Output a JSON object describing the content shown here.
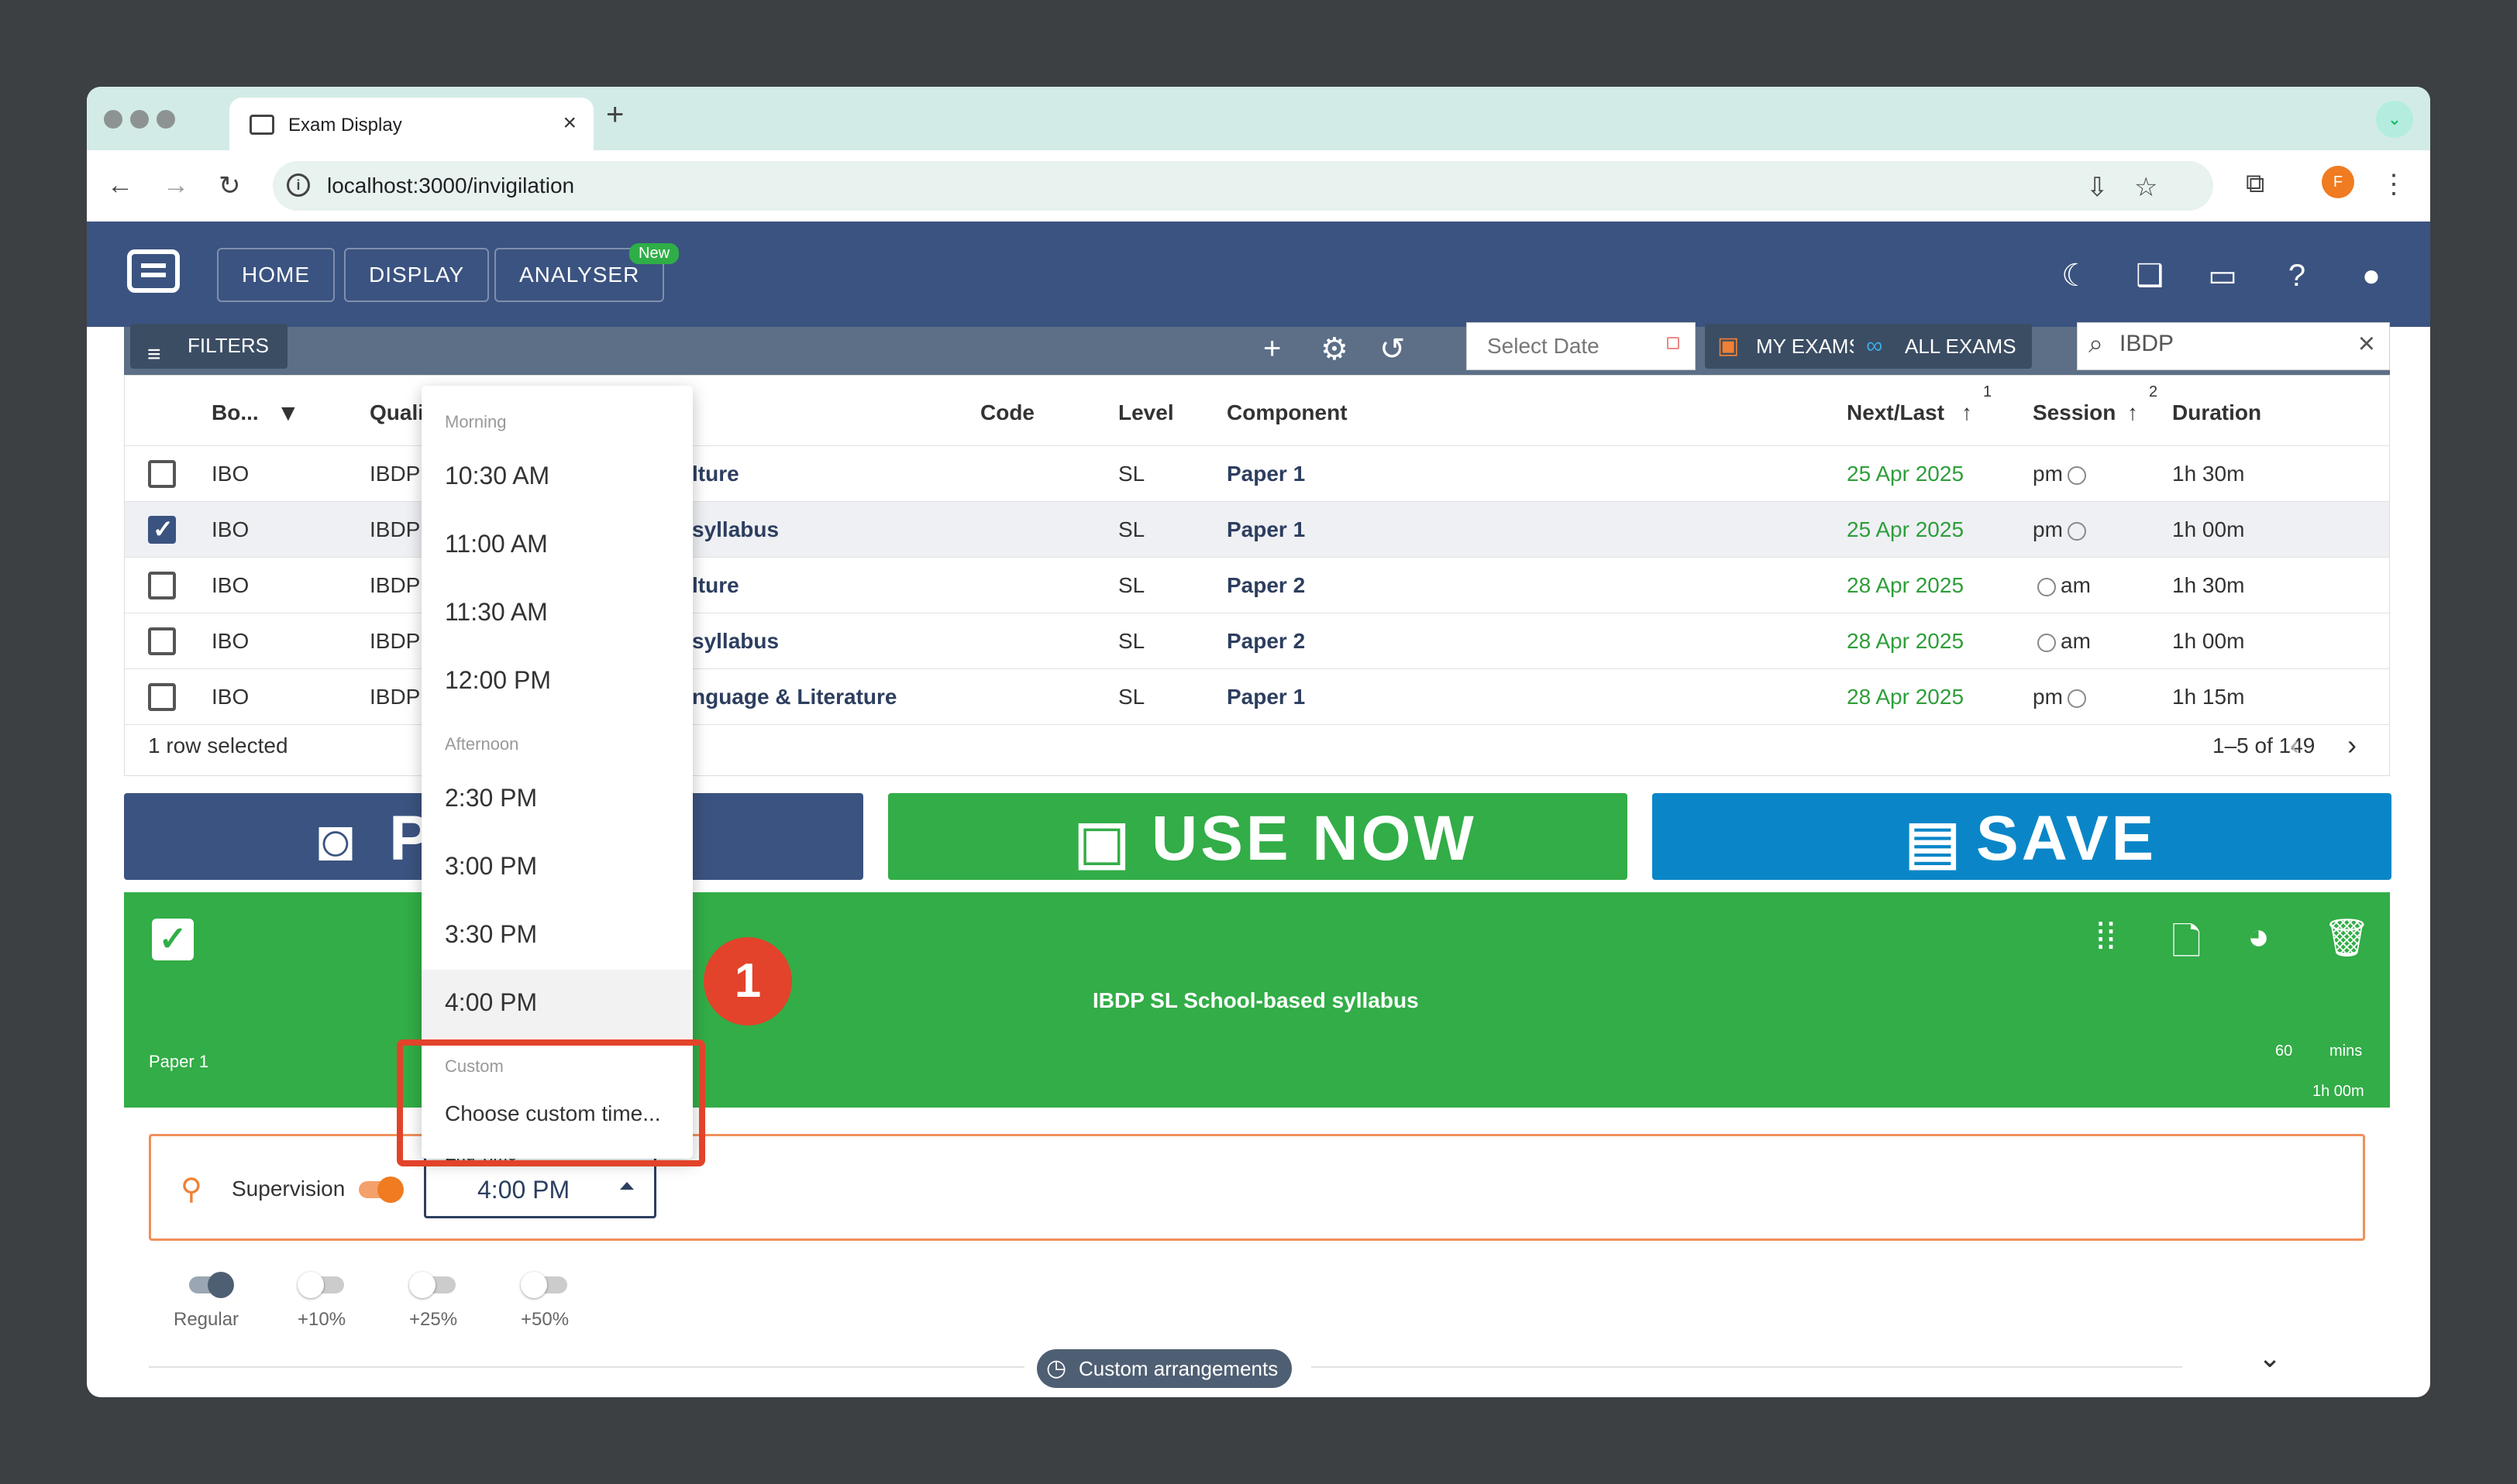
{
  "browser": {
    "tab_title": "Exam Display",
    "url": "localhost:3000/invigilation",
    "profile_initial": "F"
  },
  "app": {
    "nav": [
      "HOME",
      "DISPLAY",
      "ANALYSER"
    ],
    "new_badge": "New"
  },
  "toolbar": {
    "filters_label": "FILTERS",
    "date_placeholder": "Select Date",
    "my_exams_label": "MY EXAMS",
    "all_exams_label": "ALL EXAMS",
    "search_value": "IBDP"
  },
  "table": {
    "headers": [
      "Bo...",
      "Quali",
      "Code",
      "Level",
      "Component",
      "Next/Last",
      "Session",
      "Duration"
    ],
    "sort_indices": [
      "1",
      "2"
    ],
    "rows": [
      {
        "board": "IBO",
        "qual": "IBDP",
        "subject": "lture",
        "level": "SL",
        "component": "Paper 1",
        "date": "25 Apr 2025",
        "session": "pm",
        "duration": "1h 30m",
        "selected": false
      },
      {
        "board": "IBO",
        "qual": "IBDP",
        "subject": "syllabus",
        "level": "SL",
        "component": "Paper 1",
        "date": "25 Apr 2025",
        "session": "pm",
        "duration": "1h 00m",
        "selected": true
      },
      {
        "board": "IBO",
        "qual": "IBDP",
        "subject": "lture",
        "level": "SL",
        "component": "Paper 2",
        "date": "28 Apr 2025",
        "session": "am",
        "duration": "1h 30m",
        "selected": false
      },
      {
        "board": "IBO",
        "qual": "IBDP",
        "subject": "syllabus",
        "level": "SL",
        "component": "Paper 2",
        "date": "28 Apr 2025",
        "session": "am",
        "duration": "1h 00m",
        "selected": false
      },
      {
        "board": "IBO",
        "qual": "IBDP",
        "subject": "nguage & Literature",
        "level": "SL",
        "component": "Paper 1",
        "date": "28 Apr 2025",
        "session": "pm",
        "duration": "1h 15m",
        "selected": false
      }
    ],
    "selected_text": "1 row selected",
    "pagination": "1–5 of 149"
  },
  "actions": {
    "preview_label": "P",
    "use_now_label": "USE NOW",
    "save_label": "SAVE"
  },
  "exam_card": {
    "title": "IBDP SL School-based syllabus",
    "paper": "Paper 1",
    "minutes": "60",
    "mins_unit": "mins",
    "duration": "1h 00m"
  },
  "supervision": {
    "label": "Supervision",
    "end_time_label": "End Time",
    "end_time_value": "4:00 PM"
  },
  "extra_time": [
    "Regular",
    "+10%",
    "+25%",
    "+50%"
  ],
  "custom_arrangements": "Custom arrangements",
  "dropdown": {
    "morning_label": "Morning",
    "morning": [
      "10:30 AM",
      "11:00 AM",
      "11:30 AM",
      "12:00 PM"
    ],
    "afternoon_label": "Afternoon",
    "afternoon": [
      "2:30 PM",
      "3:00 PM",
      "3:30 PM",
      "4:00 PM"
    ],
    "custom_label": "Custom",
    "custom_option": "Choose custom time..."
  },
  "annotation": {
    "step": "1",
    "color": "#e2432a"
  }
}
